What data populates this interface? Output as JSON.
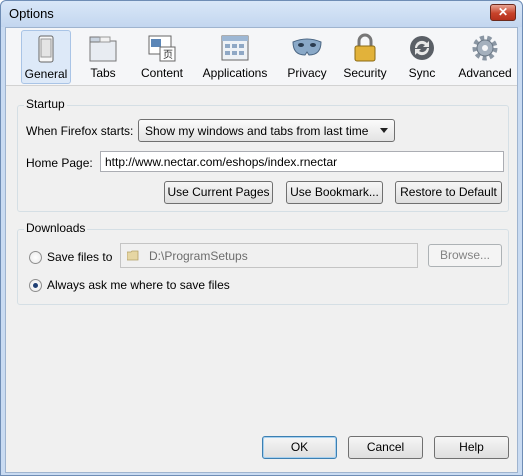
{
  "window": {
    "title": "Options",
    "close_label": "✕"
  },
  "toolbar": {
    "tabs": [
      {
        "label": "General",
        "icon": "general-icon",
        "active": true
      },
      {
        "label": "Tabs",
        "icon": "tabs-icon",
        "active": false
      },
      {
        "label": "Content",
        "icon": "content-icon",
        "active": false
      },
      {
        "label": "Applications",
        "icon": "applications-icon",
        "active": false
      },
      {
        "label": "Privacy",
        "icon": "privacy-mask-icon",
        "active": false
      },
      {
        "label": "Security",
        "icon": "padlock-icon",
        "active": false
      },
      {
        "label": "Sync",
        "icon": "sync-icon",
        "active": false
      },
      {
        "label": "Advanced",
        "icon": "gear-icon",
        "active": false
      }
    ]
  },
  "startup": {
    "legend": "Startup",
    "when_starts_label": "When Firefox starts:",
    "when_starts_value": "Show my windows and tabs from last time",
    "home_page_label": "Home Page:",
    "home_page_value": "http://www.nectar.com/eshops/index.rnectar",
    "use_current_label": "Use Current Pages",
    "use_bookmark_label": "Use Bookmark...",
    "restore_default_label": "Restore to Default"
  },
  "downloads": {
    "legend": "Downloads",
    "save_files_label": "Save files to",
    "save_path": "D:\\ProgramSetups",
    "browse_label": "Browse...",
    "always_ask_label": "Always ask me where to save files",
    "selected": "always_ask"
  },
  "footer": {
    "ok_label": "OK",
    "cancel_label": "Cancel",
    "help_label": "Help"
  },
  "colors": {
    "title_bar": "#c3d6ef",
    "close_button": "#c7432b",
    "active_tab": "#dde9f8"
  }
}
